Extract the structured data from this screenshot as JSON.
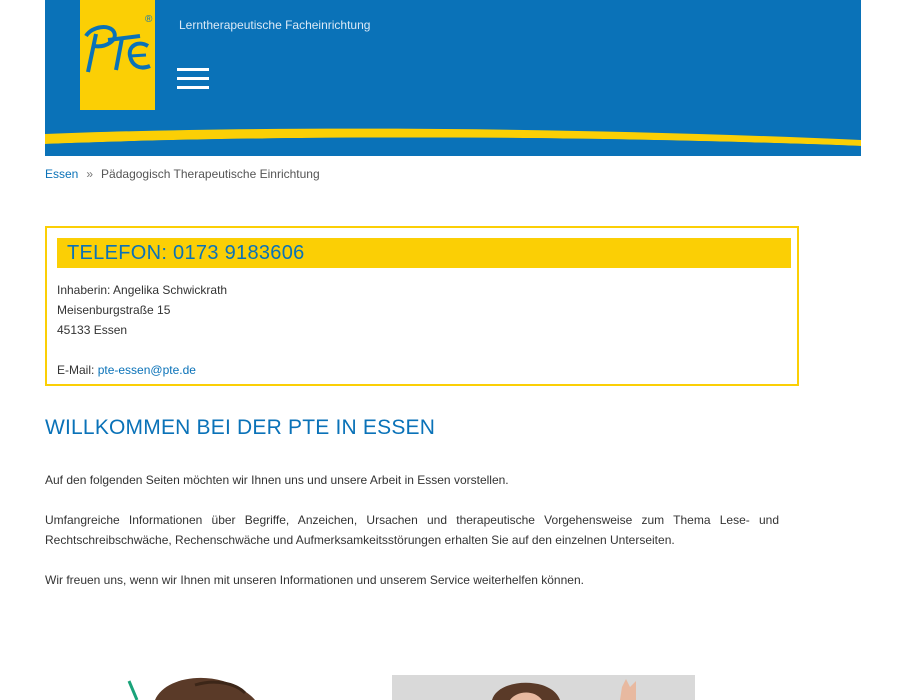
{
  "header": {
    "tagline": "Lerntherapeutische Facheinrichtung",
    "logo_text": "PTE",
    "menu_icon": "hamburger-menu-icon",
    "colors": {
      "brand_blue": "#0a72b8",
      "brand_yellow": "#fbcf05"
    }
  },
  "breadcrumb": {
    "home": "Essen",
    "separator": "»",
    "current": "Pädagogisch Therapeutische Einrichtung"
  },
  "contact": {
    "phone": "TELEFON: 0173 9183606",
    "owner": "Inhaberin: Angelika Schwickrath",
    "street": "Meisenburgstraße 15",
    "city": "45133 Essen",
    "email_label": "E-Mail:",
    "email": "pte-essen@pte.de"
  },
  "main": {
    "heading": "WILLKOMMEN BEI DER PTE IN ESSEN",
    "paragraphs": [
      "Auf den folgenden Seiten möchten wir Ihnen uns und unsere Arbeit in Essen vorstellen.",
      "Umfangreiche Informationen über Begriffe, Anzeichen, Ursachen und therapeutische Vorgehensweise zum Thema Lese- und Rechtschreibschwäche, Rechenschwäche und Aufmerksamkeitsstörungen erhalten Sie auf den einzelnen Unterseiten.",
      "Wir freuen uns, wenn wir Ihnen mit unseren Informationen und unserem Service weiterhelfen können."
    ]
  }
}
